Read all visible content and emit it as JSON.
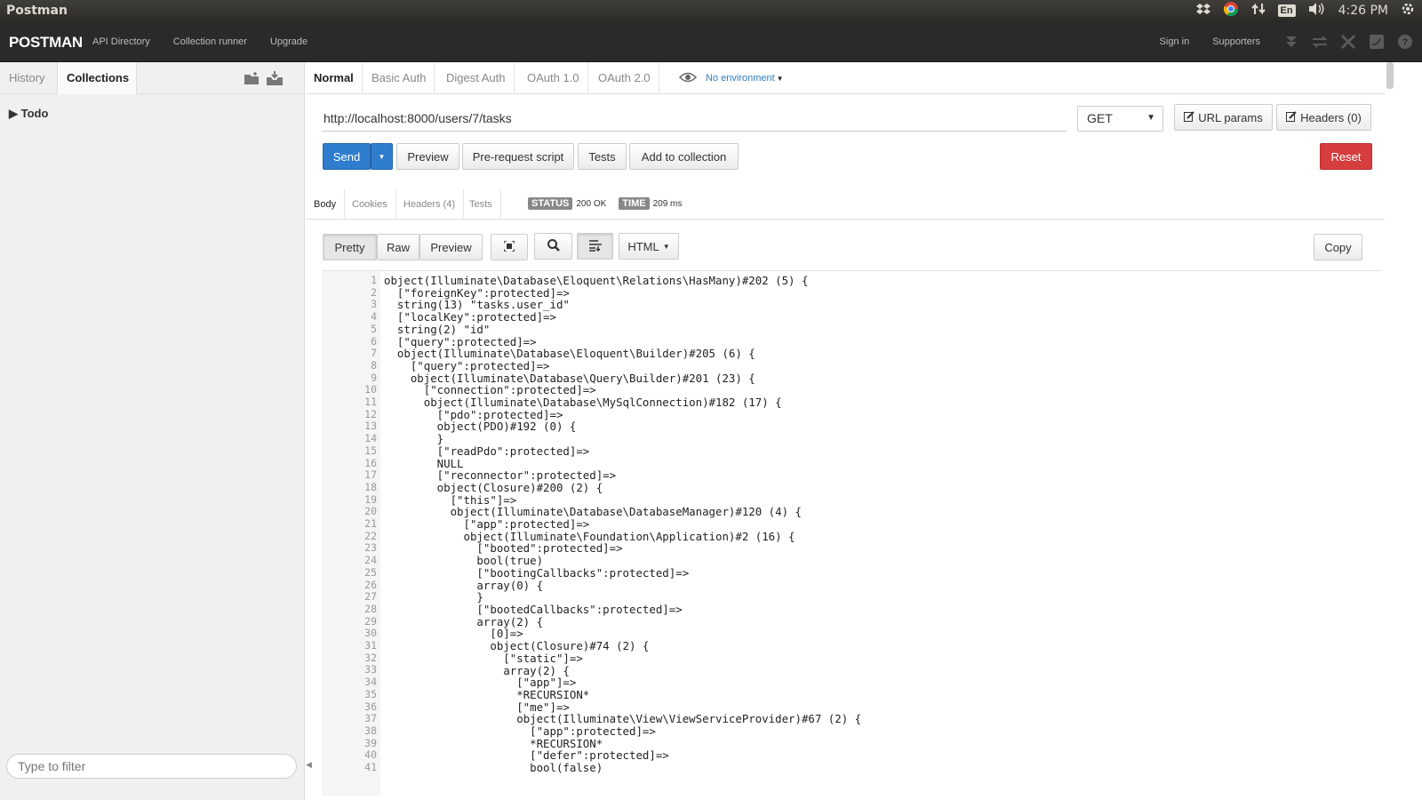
{
  "os": {
    "app_title": "Postman",
    "lang": "En",
    "clock": "4:26 PM"
  },
  "appbar": {
    "logo": "POSTMAN",
    "nav": [
      "API Directory",
      "Collection runner",
      "Upgrade"
    ],
    "sign_in": "Sign in",
    "supporters": "Supporters"
  },
  "sidebar": {
    "tabs": [
      "History",
      "Collections"
    ],
    "collection": "Todo",
    "filter_placeholder": "Type to filter"
  },
  "request": {
    "auth_tabs": [
      "Normal",
      "Basic Auth",
      "Digest Auth",
      "OAuth 1.0",
      "OAuth 2.0"
    ],
    "environment": "No environment",
    "url": "http://localhost:8000/users/7/tasks",
    "method": "GET",
    "url_params": "URL params",
    "headers": "Headers (0)",
    "send": "Send",
    "preview": "Preview",
    "prerequest": "Pre-request script",
    "tests": "Tests",
    "add_to_collection": "Add to collection",
    "reset": "Reset"
  },
  "response": {
    "tabs": [
      "Body",
      "Cookies",
      "Headers (4)",
      "Tests"
    ],
    "status_label": "STATUS",
    "status_value": "200 OK",
    "time_label": "TIME",
    "time_value": "209 ms",
    "view_modes": [
      "Pretty",
      "Raw",
      "Preview"
    ],
    "format": "HTML",
    "copy": "Copy",
    "lines": [
      "object(Illuminate\\Database\\Eloquent\\Relations\\HasMany)#202 (5) {",
      "  [\"foreignKey\":protected]=>",
      "  string(13) \"tasks.user_id\"",
      "  [\"localKey\":protected]=>",
      "  string(2) \"id\"",
      "  [\"query\":protected]=>",
      "  object(Illuminate\\Database\\Eloquent\\Builder)#205 (6) {",
      "    [\"query\":protected]=>",
      "    object(Illuminate\\Database\\Query\\Builder)#201 (23) {",
      "      [\"connection\":protected]=>",
      "      object(Illuminate\\Database\\MySqlConnection)#182 (17) {",
      "        [\"pdo\":protected]=>",
      "        object(PDO)#192 (0) {",
      "        }",
      "        [\"readPdo\":protected]=>",
      "        NULL",
      "        [\"reconnector\":protected]=>",
      "        object(Closure)#200 (2) {",
      "          [\"this\"]=>",
      "          object(Illuminate\\Database\\DatabaseManager)#120 (4) {",
      "            [\"app\":protected]=>",
      "            object(Illuminate\\Foundation\\Application)#2 (16) {",
      "              [\"booted\":protected]=>",
      "              bool(true)",
      "              [\"bootingCallbacks\":protected]=>",
      "              array(0) {",
      "              }",
      "              [\"bootedCallbacks\":protected]=>",
      "              array(2) {",
      "                [0]=>",
      "                object(Closure)#74 (2) {",
      "                  [\"static\"]=>",
      "                  array(2) {",
      "                    [\"app\"]=>",
      "                    *RECURSION*",
      "                    [\"me\"]=>",
      "                    object(Illuminate\\View\\ViewServiceProvider)#67 (2) {",
      "                      [\"app\":protected]=>",
      "                      *RECURSION*",
      "                      [\"defer\":protected]=>",
      "                      bool(false)"
    ]
  }
}
